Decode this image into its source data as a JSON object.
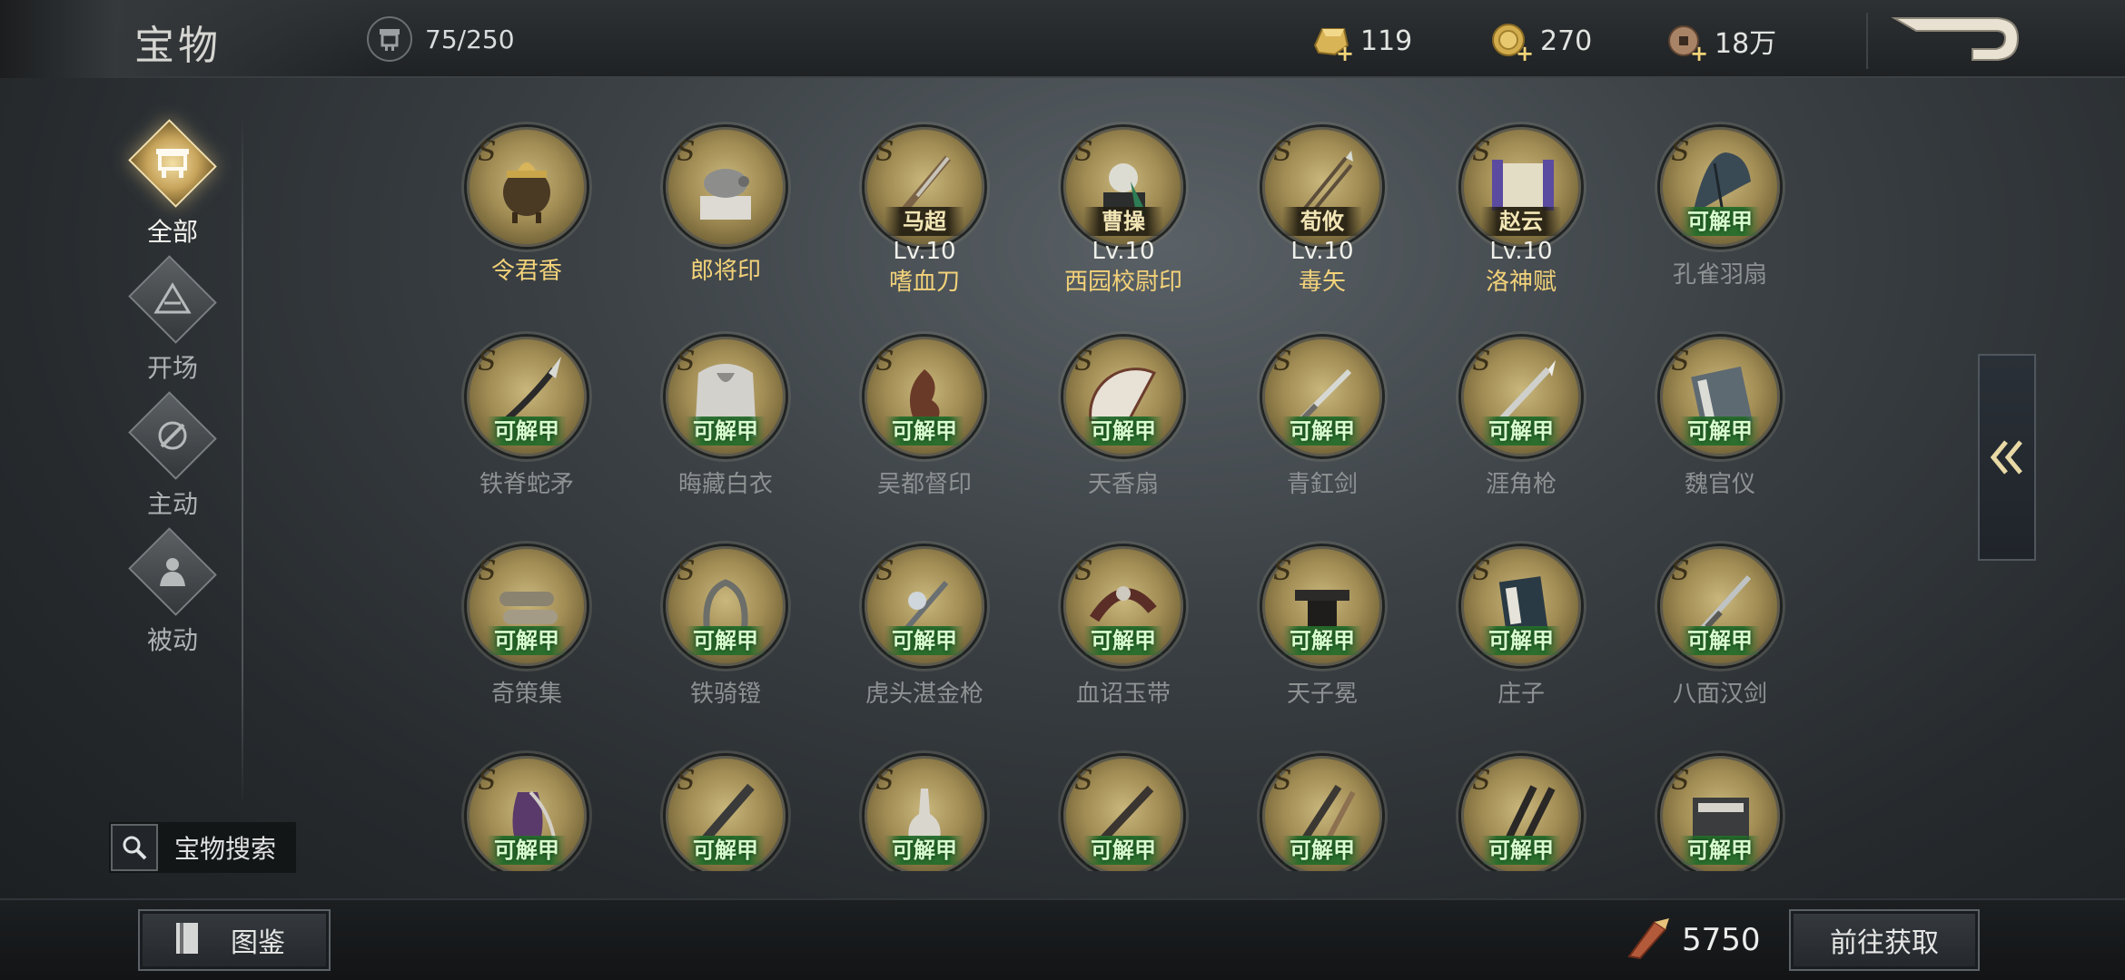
{
  "header": {
    "title": "宝物",
    "capacity": "75/250",
    "currencies": [
      {
        "icon": "gold-ingot-icon",
        "value": "119"
      },
      {
        "icon": "gold-coin-icon",
        "value": "270"
      },
      {
        "icon": "copper-coin-icon",
        "value": "18万"
      }
    ],
    "back_icon": "back-arrow-icon"
  },
  "sidebar": {
    "categories": [
      {
        "label": "全部",
        "icon": "all-treasures-icon",
        "active": true
      },
      {
        "label": "开场",
        "icon": "opening-icon",
        "active": false
      },
      {
        "label": "主动",
        "icon": "active-skill-icon",
        "active": false
      },
      {
        "label": "被动",
        "icon": "passive-skill-icon",
        "active": false
      }
    ],
    "search_label": "宝物搜索"
  },
  "grid": {
    "grade_letter": "S",
    "unlock_label": "可解甲",
    "items": [
      {
        "name": "令君香",
        "owned": true,
        "owner": "",
        "level": "",
        "art": "censer"
      },
      {
        "name": "郎将印",
        "owned": true,
        "owner": "",
        "level": "",
        "art": "seal"
      },
      {
        "name": "嗜血刀",
        "owned": true,
        "owner": "马超",
        "level": "Lv.10",
        "art": "blade"
      },
      {
        "name": "西园校尉印",
        "owned": true,
        "owner": "曹操",
        "level": "Lv.10",
        "art": "seal2"
      },
      {
        "name": "毒矢",
        "owned": true,
        "owner": "荀攸",
        "level": "Lv.10",
        "art": "arrows"
      },
      {
        "name": "洛神赋",
        "owned": true,
        "owner": "赵云",
        "level": "Lv.10",
        "art": "scroll"
      },
      {
        "name": "孔雀羽扇",
        "owned": false,
        "owner": "",
        "level": "",
        "art": "feather"
      },
      {
        "name": "铁脊蛇矛",
        "owned": false,
        "owner": "",
        "level": "",
        "art": "spear"
      },
      {
        "name": "晦藏白衣",
        "owned": false,
        "owner": "",
        "level": "",
        "art": "cloak"
      },
      {
        "name": "吴都督印",
        "owned": false,
        "owner": "",
        "level": "",
        "art": "seal3"
      },
      {
        "name": "天香扇",
        "owned": false,
        "owner": "",
        "level": "",
        "art": "fan"
      },
      {
        "name": "青釭剑",
        "owned": false,
        "owner": "",
        "level": "",
        "art": "sword"
      },
      {
        "name": "涯角枪",
        "owned": false,
        "owner": "",
        "level": "",
        "art": "lance"
      },
      {
        "name": "魏官仪",
        "owned": false,
        "owner": "",
        "level": "",
        "art": "book"
      },
      {
        "name": "奇策集",
        "owned": false,
        "owner": "",
        "level": "",
        "art": "scrolls"
      },
      {
        "name": "铁骑镫",
        "owned": false,
        "owner": "",
        "level": "",
        "art": "stirrup"
      },
      {
        "name": "虎头湛金枪",
        "owned": false,
        "owner": "",
        "level": "",
        "art": "halberd"
      },
      {
        "name": "血诏玉带",
        "owned": false,
        "owner": "",
        "level": "",
        "art": "belt"
      },
      {
        "name": "天子冕",
        "owned": false,
        "owner": "",
        "level": "",
        "art": "crown"
      },
      {
        "name": "庄子",
        "owned": false,
        "owner": "",
        "level": "",
        "art": "book2"
      },
      {
        "name": "八面汉剑",
        "owned": false,
        "owner": "",
        "level": "",
        "art": "sword2"
      },
      {
        "name": "",
        "owned": false,
        "owner": "",
        "level": "",
        "art": "vase"
      },
      {
        "name": "",
        "owned": false,
        "owner": "",
        "level": "",
        "art": "club"
      },
      {
        "name": "",
        "owned": false,
        "owner": "",
        "level": "",
        "art": "bottle"
      },
      {
        "name": "",
        "owned": false,
        "owner": "",
        "level": "",
        "art": "flute"
      },
      {
        "name": "",
        "owned": false,
        "owner": "",
        "level": "",
        "art": "brush"
      },
      {
        "name": "",
        "owned": false,
        "owner": "",
        "level": "",
        "art": "sticks"
      },
      {
        "name": "",
        "owned": false,
        "owner": "",
        "level": "",
        "art": "box"
      }
    ]
  },
  "collapse_icon": "double-chevron-left-icon",
  "footer": {
    "codex_label": "图鉴",
    "shard_value": "5750",
    "goto_label": "前往获取"
  },
  "colors": {
    "owned_name": "#f3d27a",
    "locked_name": "#8e9293",
    "unlock_tag": "#26702c",
    "active_category": "#c7a45b"
  }
}
